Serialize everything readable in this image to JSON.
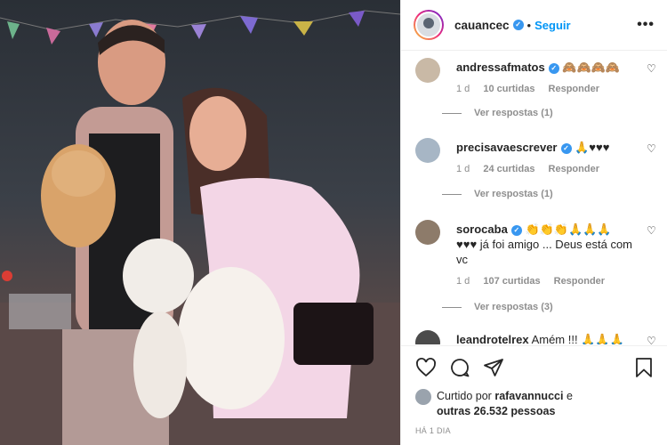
{
  "post": {
    "author": "cauancec",
    "follow_label": "Seguir",
    "more_label": "•••",
    "dot": "•"
  },
  "comments": [
    {
      "user": "andressafmatos",
      "text": "🙈🙈🙈🙈",
      "time": "1 d",
      "likes": "10 curtidas",
      "reply": "Responder",
      "view_replies": "Ver respostas (1)"
    },
    {
      "user": "precisavaescrever",
      "text": "🙏♥♥♥",
      "time": "1 d",
      "likes": "24 curtidas",
      "reply": "Responder",
      "view_replies": "Ver respostas (1)"
    },
    {
      "user": "sorocaba",
      "text": "👏👏👏🙏🙏🙏 ♥♥♥ já foi amigo ... Deus está com vc",
      "time": "1 d",
      "likes": "107 curtidas",
      "reply": "Responder",
      "view_replies": "Ver respostas (3)"
    },
    {
      "user": "leandrotelrex",
      "text": "Amém !!! 🙏🙏🙏"
    }
  ],
  "likes": {
    "prefix": "Curtido por",
    "user": "rafavannucci",
    "and": "e",
    "others": "outras 26.532 pessoas"
  },
  "time_ago": "HÁ 1 DIA",
  "icons": [
    "heart-icon",
    "comment-icon",
    "share-icon",
    "bookmark-icon"
  ],
  "colors": {
    "accent": "#0095f6",
    "verified": "#3897f0"
  }
}
